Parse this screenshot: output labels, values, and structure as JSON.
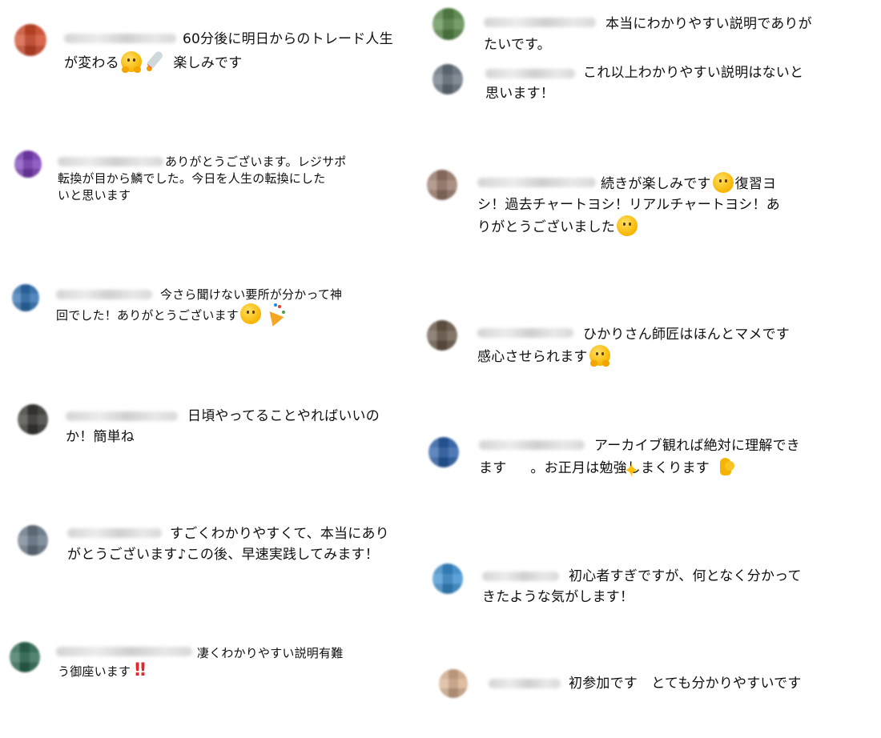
{
  "colors": {
    "text": "#0f0f0f",
    "bang": "#e0282e"
  },
  "left": [
    {
      "text_before": "60分後に明日からのトレード人生\nが変わる",
      "icons": [
        "hug-emoji",
        "rocket-emoji"
      ],
      "text_after": "楽しみです",
      "avatar": "#d04a2a"
    },
    {
      "text": "ありがとうございます。レジサポ\n転換が目から鱗でした。今日を人生の転換にした\nいと思います",
      "avatar": "#7b3fb8"
    },
    {
      "text_before": "今さら聞けない要所が分かって神\n回でした！ありがとうございます",
      "icons": [
        "smile-emoji",
        "party-popper-emoji"
      ],
      "avatar": "#2f6fb0"
    },
    {
      "text": "日頃やってることやればいいの\nか！簡単ね",
      "avatar": "#3b3a35"
    },
    {
      "text": "すごくわかりやすくて、本当にあり\nがとうございます♪この後、早速実践してみます！",
      "avatar": "#6b7a8a"
    },
    {
      "text_before": "凄くわかりやすい説明有難\nう御座います",
      "bang": "‼",
      "avatar": "#2e6b52"
    }
  ],
  "right": [
    {
      "text": "本当にわかりやすい説明でありが\nたいです。",
      "avatar": "#5a8a4a"
    },
    {
      "text": "これ以上わかりやすい説明はないと\n思います！",
      "avatar": "#6a7580"
    },
    {
      "text_before": "続きが楽しみです",
      "text_mid": "復習ヨ\nシ！過去チャートヨシ！リアルチャートヨシ！あ\nりがとうございました",
      "icons": [
        "laughing-emoji",
        "grin-emoji"
      ],
      "avatar": "#9a7a6a"
    },
    {
      "text_before": "ひかりさん師匠はほんとマメです\n感心させられます",
      "icons": [
        "hug-emoji"
      ],
      "avatar": "#6a5a4a"
    },
    {
      "text_before": "アーカイブ観れば絶対に理解でき\nます",
      "text_mid": "。お正月は勉強しまくります",
      "icons": [
        "sparkles-emoji",
        "flexed-biceps-emoji"
      ],
      "avatar": "#2a5fa8"
    },
    {
      "text": "初心者すぎですが、何となく分かって\nきたような気がします！",
      "avatar": "#3a8fd0"
    },
    {
      "text": "初参加です　とても分かりやすいです",
      "avatar": "#d8b090"
    }
  ]
}
